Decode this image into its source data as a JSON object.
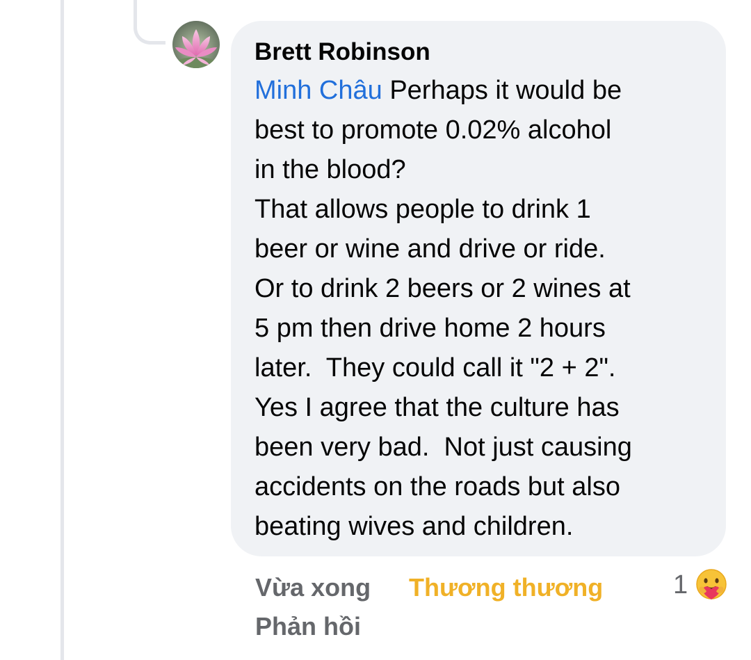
{
  "comment": {
    "author": "Brett Robinson",
    "mention": "Minh Châu",
    "lines": [
      " Perhaps it would be",
      "best to promote 0.02% alcohol",
      "in the blood?",
      "That allows people to drink 1",
      "beer or wine and drive or ride.",
      "Or to drink 2 beers or 2 wines at",
      "5 pm then drive home 2 hours",
      "later.  They could call it \"2 + 2\".",
      "Yes I agree that the culture has",
      "been very bad.  Not just causing",
      "accidents on the roads but also",
      "beating wives and children."
    ]
  },
  "actions": {
    "time": "Vừa xong",
    "reaction": "Thương thương",
    "reply": "Phản hồi"
  },
  "reactions": {
    "count": "1",
    "icon": "care-emoji-icon"
  },
  "colors": {
    "mention": "#216fdb",
    "reaction_label": "#f0b127",
    "bubble": "#f0f2f5",
    "meta": "#65676b"
  }
}
